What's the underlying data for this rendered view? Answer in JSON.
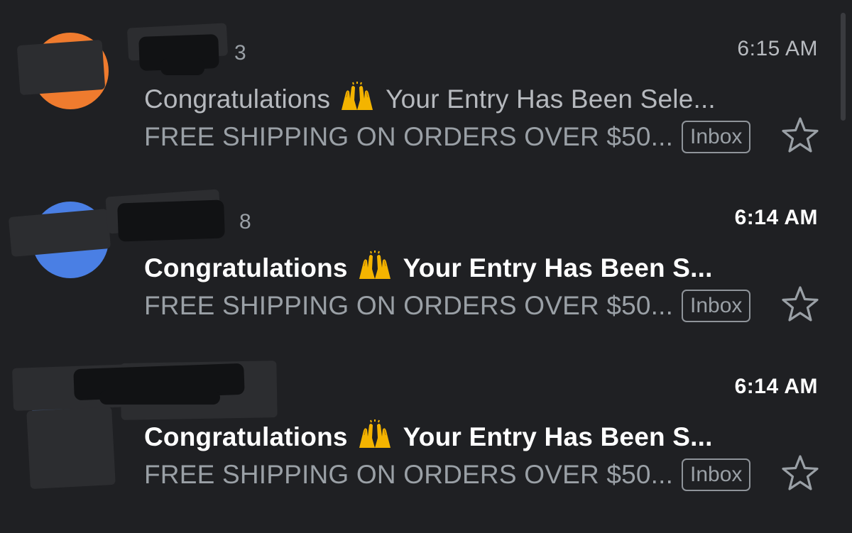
{
  "colors": {
    "background": "#1f2023",
    "avatar_orange": "#ef7b2e",
    "avatar_blue": "#4a7fe4",
    "read_text": "#b6b9be",
    "snippet_text": "#9aa0a6"
  },
  "messages": [
    {
      "count": "3",
      "time": "6:15 AM",
      "subject_start": "Congratulations",
      "subject_icon": "raising-hands-icon",
      "subject_end": "Your Entry Has Been Sele...",
      "snippet": "FREE SHIPPING ON ORDERS OVER $50...",
      "label": "Inbox",
      "unread": false,
      "starred": false
    },
    {
      "count": "8",
      "time": "6:14 AM",
      "subject_start": "Congratulations",
      "subject_icon": "raising-hands-icon",
      "subject_end": "Your Entry Has Been S...",
      "snippet": "FREE SHIPPING ON ORDERS OVER $50...",
      "label": "Inbox",
      "unread": true,
      "starred": false
    },
    {
      "count": "",
      "time": "6:14 AM",
      "subject_start": "Congratulations",
      "subject_icon": "raising-hands-icon",
      "subject_end": "Your Entry Has Been S...",
      "snippet": "FREE SHIPPING ON ORDERS OVER $50...",
      "label": "Inbox",
      "unread": true,
      "starred": false
    }
  ]
}
